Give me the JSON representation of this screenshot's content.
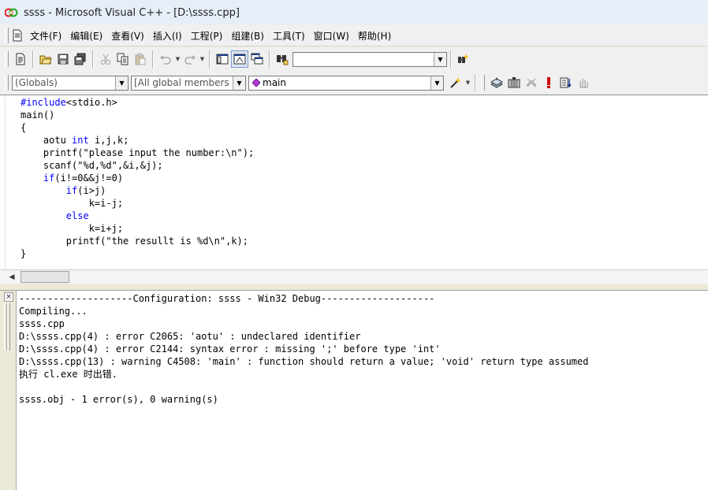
{
  "window": {
    "title": "ssss - Microsoft Visual C++ - [D:\\ssss.cpp]"
  },
  "menu": {
    "items": [
      {
        "label": "文件(F)"
      },
      {
        "label": "编辑(E)"
      },
      {
        "label": "查看(V)"
      },
      {
        "label": "插入(I)"
      },
      {
        "label": "工程(P)"
      },
      {
        "label": "组建(B)"
      },
      {
        "label": "工具(T)"
      },
      {
        "label": "窗口(W)"
      },
      {
        "label": "帮助(H)"
      }
    ]
  },
  "toolbar": {
    "find_combo_value": ""
  },
  "wizardbar": {
    "class_combo": "(Globals)",
    "filter_combo": "[All global members",
    "member_combo": "main"
  },
  "editor": {
    "lines": [
      [
        {
          "t": "#include",
          "kw": true
        },
        {
          "t": "<stdio.h>"
        }
      ],
      [
        {
          "t": "main()"
        }
      ],
      [
        {
          "t": "{"
        }
      ],
      [
        {
          "t": "    aotu "
        },
        {
          "t": "int",
          "kw": true
        },
        {
          "t": " i,j,k;"
        }
      ],
      [
        {
          "t": "    printf(\"please input the number:\\n\");"
        }
      ],
      [
        {
          "t": "    scanf(\"%d,%d\",&i,&j);"
        }
      ],
      [
        {
          "t": "    "
        },
        {
          "t": "if",
          "kw": true
        },
        {
          "t": "(i!=0&&j!=0)"
        }
      ],
      [
        {
          "t": "        "
        },
        {
          "t": "if",
          "kw": true
        },
        {
          "t": "(i>j)"
        }
      ],
      [
        {
          "t": "            k=i-j;"
        }
      ],
      [
        {
          "t": "        "
        },
        {
          "t": "else",
          "kw": true
        }
      ],
      [
        {
          "t": "            k=i+j;"
        }
      ],
      [
        {
          "t": "        printf(\"the resullt is %d\\n\",k);"
        }
      ],
      [
        {
          "t": "}"
        }
      ]
    ]
  },
  "output": {
    "lines": [
      "--------------------Configuration: ssss - Win32 Debug--------------------",
      "Compiling...",
      "ssss.cpp",
      "D:\\ssss.cpp(4) : error C2065: 'aotu' : undeclared identifier",
      "D:\\ssss.cpp(4) : error C2144: syntax error : missing ';' before type 'int'",
      "D:\\ssss.cpp(13) : warning C4508: 'main' : function should return a value; 'void' return type assumed",
      "执行 cl.exe 时出错.",
      "",
      "ssss.obj - 1 error(s), 0 warning(s)"
    ]
  },
  "colors": {
    "keyword": "#0000ff",
    "chrome": "#f0f0f0",
    "titlebar": "#e6eef7"
  },
  "icons": [
    "vc-app-icon",
    "new-text-icon",
    "open-folder-icon",
    "save-icon",
    "save-all-icon",
    "cut-icon",
    "copy-icon",
    "paste-icon",
    "undo-icon",
    "redo-icon",
    "workspace-icon",
    "output-window-icon",
    "window-list-icon",
    "find-in-files-icon",
    "search-icon",
    "compile-icon",
    "build-icon",
    "stop-build-icon",
    "execute-icon",
    "breakpoint-icon",
    "hand-icon",
    "wand-icon",
    "dropdown-icon",
    "close-icon"
  ]
}
